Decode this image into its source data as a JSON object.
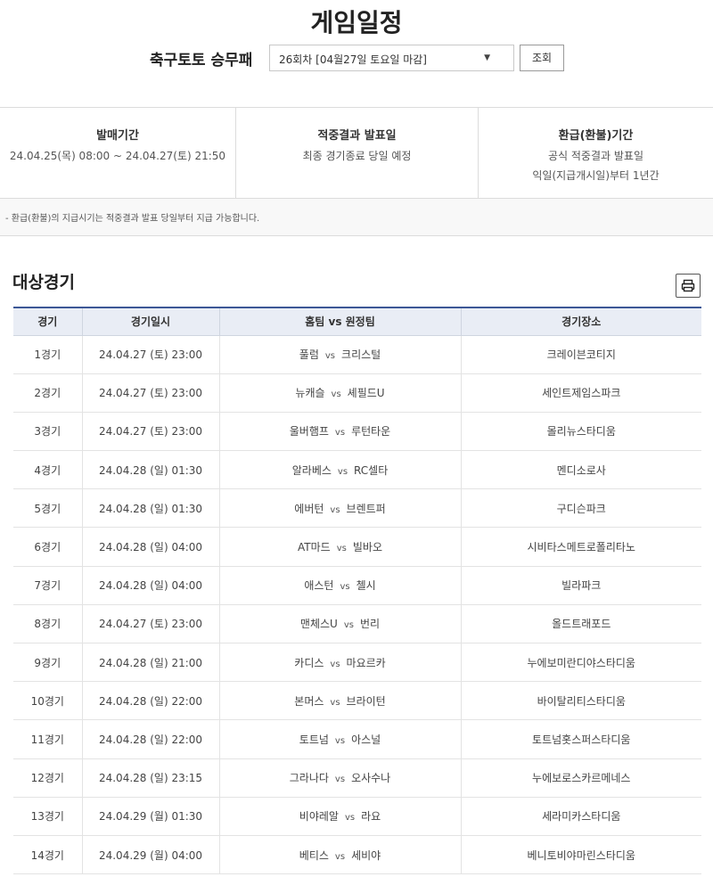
{
  "header": {
    "title": "게임일정",
    "game_type": "축구토토 승무패",
    "round_select": "26회차 [04월27일 토요일 마감]",
    "search_label": "조회"
  },
  "info": {
    "sales": {
      "head": "발매기간",
      "lines": [
        "24.04.25(목) 08:00 ~ 24.04.27(토) 21:50"
      ]
    },
    "result": {
      "head": "적중결과 발표일",
      "lines": [
        "최종 경기종료 당일 예정"
      ]
    },
    "refund": {
      "head": "환급(환불)기간",
      "lines": [
        "공식 적중결과 발표일",
        "익일(지급개시일)부터 1년간"
      ]
    },
    "note": "- 환급(환불)의 지급시기는 적중결과 발표 당일부터 지급 가능합니다."
  },
  "section_title": "대상경기",
  "print_icon": "printer-icon",
  "table": {
    "headers": [
      "경기",
      "경기일시",
      "홈팀 vs 원정팀",
      "경기장소"
    ],
    "vs_label": "vs",
    "rows": [
      {
        "no": "1경기",
        "datetime": "24.04.27 (토) 23:00",
        "home": "풀럼",
        "away": "크리스털",
        "venue": "크레이븐코티지"
      },
      {
        "no": "2경기",
        "datetime": "24.04.27 (토) 23:00",
        "home": "뉴캐슬",
        "away": "셰필드U",
        "venue": "세인트제임스파크"
      },
      {
        "no": "3경기",
        "datetime": "24.04.27 (토) 23:00",
        "home": "울버햄프",
        "away": "루턴타운",
        "venue": "몰리뉴스타디움"
      },
      {
        "no": "4경기",
        "datetime": "24.04.28 (일) 01:30",
        "home": "알라베스",
        "away": "RC셀타",
        "venue": "멘디소로사"
      },
      {
        "no": "5경기",
        "datetime": "24.04.28 (일) 01:30",
        "home": "에버턴",
        "away": "브렌트퍼",
        "venue": "구디슨파크"
      },
      {
        "no": "6경기",
        "datetime": "24.04.28 (일) 04:00",
        "home": "AT마드",
        "away": "빌바오",
        "venue": "시비타스메트로폴리타노"
      },
      {
        "no": "7경기",
        "datetime": "24.04.28 (일) 04:00",
        "home": "애스턴",
        "away": "첼시",
        "venue": "빌라파크"
      },
      {
        "no": "8경기",
        "datetime": "24.04.27 (토) 23:00",
        "home": "맨체스U",
        "away": "번리",
        "venue": "올드트래포드"
      },
      {
        "no": "9경기",
        "datetime": "24.04.28 (일) 21:00",
        "home": "카디스",
        "away": "마요르카",
        "venue": "누에보미란디야스타디움"
      },
      {
        "no": "10경기",
        "datetime": "24.04.28 (일) 22:00",
        "home": "본머스",
        "away": "브라이턴",
        "venue": "바이탈리티스타디움"
      },
      {
        "no": "11경기",
        "datetime": "24.04.28 (일) 22:00",
        "home": "토트넘",
        "away": "아스널",
        "venue": "토트넘홋스퍼스타디움"
      },
      {
        "no": "12경기",
        "datetime": "24.04.28 (일) 23:15",
        "home": "그라나다",
        "away": "오사수나",
        "venue": "누에보로스카르메네스"
      },
      {
        "no": "13경기",
        "datetime": "24.04.29 (월) 01:30",
        "home": "비야레알",
        "away": "라요",
        "venue": "세라미카스타디움"
      },
      {
        "no": "14경기",
        "datetime": "24.04.29 (월) 04:00",
        "home": "베티스",
        "away": "세비야",
        "venue": "베니토비야마린스타디움"
      }
    ]
  },
  "colors": {
    "header_border": "#3c5796",
    "header_bg": "#e9edf5",
    "info_bg": "#f8f8f8"
  }
}
